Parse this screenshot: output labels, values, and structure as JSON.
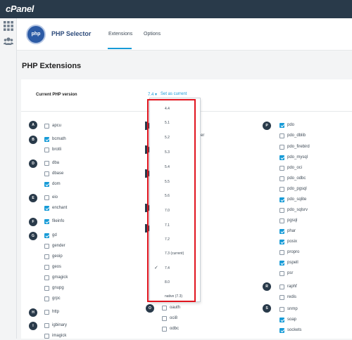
{
  "topbar": {
    "logo": "cPanel"
  },
  "header": {
    "app_logo": "php",
    "app_title": "PHP Selector",
    "tabs": [
      {
        "label": "Extensions",
        "active": true
      },
      {
        "label": "Options",
        "active": false
      }
    ]
  },
  "page_title": "PHP Extensions",
  "php_version": {
    "label": "Current PHP version",
    "selected": "7.4 ▾",
    "set_current": "Set as current"
  },
  "dropdown": {
    "options": [
      "4.4",
      "5.1",
      "5.2",
      "5.3",
      "5.4",
      "5.5",
      "5.6",
      "7.0",
      "7.1",
      "7.2",
      "7.3 (current)",
      "7.4",
      "8.0",
      "native (7.3)"
    ],
    "selected_index": 11
  },
  "col1": [
    {
      "letter": "A",
      "items": [
        {
          "name": "apcu",
          "checked": false
        }
      ]
    },
    {
      "letter": "B",
      "items": [
        {
          "name": "bcmath",
          "checked": true
        },
        {
          "name": "brotli",
          "checked": false
        }
      ]
    },
    {
      "letter": "D",
      "items": [
        {
          "name": "dba",
          "checked": false
        },
        {
          "name": "dbase",
          "checked": false
        },
        {
          "name": "dom",
          "checked": true
        }
      ]
    },
    {
      "letter": "E",
      "items": [
        {
          "name": "eio",
          "checked": false
        },
        {
          "name": "enchant",
          "checked": true
        }
      ]
    },
    {
      "letter": "F",
      "items": [
        {
          "name": "fileinfo",
          "checked": true
        }
      ]
    },
    {
      "letter": "G",
      "items": [
        {
          "name": "gd",
          "checked": true
        },
        {
          "name": "gender",
          "checked": false
        },
        {
          "name": "geoip",
          "checked": false
        },
        {
          "name": "geos",
          "checked": false
        },
        {
          "name": "gmagick",
          "checked": false
        },
        {
          "name": "gnupg",
          "checked": false
        },
        {
          "name": "grpc",
          "checked": false
        }
      ]
    },
    {
      "letter": "H",
      "items": [
        {
          "name": "http",
          "checked": false
        }
      ]
    },
    {
      "letter": "I",
      "items": [
        {
          "name": "igbinary",
          "checked": false
        },
        {
          "name": "imagick",
          "checked": false
        }
      ]
    }
  ],
  "col2_visible": {
    "partial_label": "er",
    "letter": "O",
    "items": [
      {
        "name": "oauth",
        "checked": false
      },
      {
        "name": "oci8",
        "checked": false
      },
      {
        "name": "odbc",
        "checked": false
      }
    ]
  },
  "col3": [
    {
      "letter": "P",
      "items": [
        {
          "name": "pdo",
          "checked": true
        },
        {
          "name": "pdo_dblib",
          "checked": false
        },
        {
          "name": "pdo_firebird",
          "checked": false
        },
        {
          "name": "pdo_mysql",
          "checked": true
        },
        {
          "name": "pdo_oci",
          "checked": false
        },
        {
          "name": "pdo_odbc",
          "checked": false
        },
        {
          "name": "pdo_pgsql",
          "checked": false
        },
        {
          "name": "pdo_sqlite",
          "checked": true
        },
        {
          "name": "pdo_sqlsrv",
          "checked": false
        },
        {
          "name": "pgsql",
          "checked": false
        },
        {
          "name": "phar",
          "checked": true
        },
        {
          "name": "posix",
          "checked": true
        },
        {
          "name": "propro",
          "checked": false
        },
        {
          "name": "pspell",
          "checked": true
        },
        {
          "name": "psr",
          "checked": false
        }
      ]
    },
    {
      "letter": "R",
      "items": [
        {
          "name": "raphf",
          "checked": false
        },
        {
          "name": "redis",
          "checked": false
        }
      ]
    },
    {
      "letter": "S",
      "items": [
        {
          "name": "snmp",
          "checked": false
        },
        {
          "name": "soap",
          "checked": true
        },
        {
          "name": "sockets",
          "checked": true
        }
      ]
    }
  ]
}
